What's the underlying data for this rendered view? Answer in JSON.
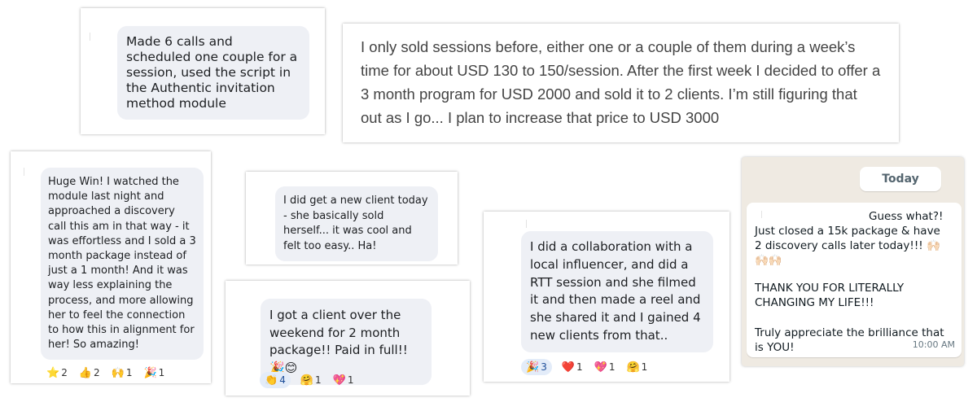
{
  "testimonials": {
    "t1": {
      "text": "Made 6 calls and scheduled one couple for a session, used the script in the Authentic invitation method module"
    },
    "t2": {
      "text": "I only sold sessions before, either one or a couple of them during a week’s time for about USD 130 to 150/session. After the first week I decided to offer a 3 month program for USD 2000 and sold it to 2 clients. I’m still figuring that out as I go... I plan to increase that price to USD 3000"
    },
    "t3": {
      "text": "Huge Win! I watched the module last night and approached a discovery call this am in that way - it was effortless and I sold a 3 month package instead of just a 1 month! And it was way less explaining the process, and more allowing her to feel the connection to how this in alignment for her! So amazing!",
      "reactions": [
        {
          "emoji": "⭐",
          "count": "2"
        },
        {
          "emoji": "👍",
          "count": "2"
        },
        {
          "emoji": "🙌",
          "count": "1"
        },
        {
          "emoji": "🎉",
          "count": "1"
        }
      ]
    },
    "t4": {
      "text": "I did get a new client today - she basically sold herself... it was cool and felt too easy.. Ha!"
    },
    "t5": {
      "text": "I got a client over the weekend for 2 month package!! Paid in full!!🎉😊",
      "reactions": [
        {
          "emoji": "👏",
          "count": "4"
        },
        {
          "emoji": "🤗",
          "count": "1"
        },
        {
          "emoji": "💖",
          "count": "1"
        }
      ]
    },
    "t6": {
      "text": "I did a collaboration with a local influencer, and did a RTT session and she filmed it and then made a reel and she shared it and I gained 4 new clients from that..",
      "reactions": [
        {
          "emoji": "🎉",
          "count": "3"
        },
        {
          "emoji": "❤️",
          "count": "1"
        },
        {
          "emoji": "💖",
          "count": "1"
        },
        {
          "emoji": "🤗",
          "count": "1"
        }
      ]
    }
  },
  "whatsapp": {
    "date_label": "Today",
    "line1": "Guess what?! Just closed a 15k package & have 2 discovery calls later today!!! 🙌🏻🙌🏻🙌🏻",
    "line2": "THANK YOU FOR LITERALLY CHANGING MY LIFE!!!",
    "line3": "Truly appreciate the brilliance that is YOU!",
    "time": "10:00 AM"
  }
}
